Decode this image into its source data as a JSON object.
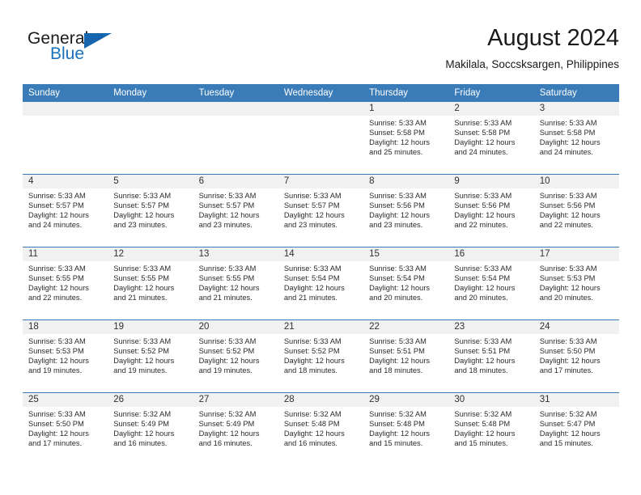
{
  "brand": {
    "name_part1": "General",
    "name_part2": "Blue"
  },
  "header": {
    "month_title": "August 2024",
    "location": "Makilala, Soccsksargen, Philippines"
  },
  "colors": {
    "header_blue": "#3a7cb8",
    "logo_blue": "#1872bc",
    "day_band": "#f1f1f1"
  },
  "weekdays": [
    "Sunday",
    "Monday",
    "Tuesday",
    "Wednesday",
    "Thursday",
    "Friday",
    "Saturday"
  ],
  "weeks": [
    [
      {
        "day": "",
        "sunrise": "",
        "sunset": "",
        "daylight_line1": "",
        "daylight_line2": ""
      },
      {
        "day": "",
        "sunrise": "",
        "sunset": "",
        "daylight_line1": "",
        "daylight_line2": ""
      },
      {
        "day": "",
        "sunrise": "",
        "sunset": "",
        "daylight_line1": "",
        "daylight_line2": ""
      },
      {
        "day": "",
        "sunrise": "",
        "sunset": "",
        "daylight_line1": "",
        "daylight_line2": ""
      },
      {
        "day": "1",
        "sunrise": "Sunrise: 5:33 AM",
        "sunset": "Sunset: 5:58 PM",
        "daylight_line1": "Daylight: 12 hours",
        "daylight_line2": "and 25 minutes."
      },
      {
        "day": "2",
        "sunrise": "Sunrise: 5:33 AM",
        "sunset": "Sunset: 5:58 PM",
        "daylight_line1": "Daylight: 12 hours",
        "daylight_line2": "and 24 minutes."
      },
      {
        "day": "3",
        "sunrise": "Sunrise: 5:33 AM",
        "sunset": "Sunset: 5:58 PM",
        "daylight_line1": "Daylight: 12 hours",
        "daylight_line2": "and 24 minutes."
      }
    ],
    [
      {
        "day": "4",
        "sunrise": "Sunrise: 5:33 AM",
        "sunset": "Sunset: 5:57 PM",
        "daylight_line1": "Daylight: 12 hours",
        "daylight_line2": "and 24 minutes."
      },
      {
        "day": "5",
        "sunrise": "Sunrise: 5:33 AM",
        "sunset": "Sunset: 5:57 PM",
        "daylight_line1": "Daylight: 12 hours",
        "daylight_line2": "and 23 minutes."
      },
      {
        "day": "6",
        "sunrise": "Sunrise: 5:33 AM",
        "sunset": "Sunset: 5:57 PM",
        "daylight_line1": "Daylight: 12 hours",
        "daylight_line2": "and 23 minutes."
      },
      {
        "day": "7",
        "sunrise": "Sunrise: 5:33 AM",
        "sunset": "Sunset: 5:57 PM",
        "daylight_line1": "Daylight: 12 hours",
        "daylight_line2": "and 23 minutes."
      },
      {
        "day": "8",
        "sunrise": "Sunrise: 5:33 AM",
        "sunset": "Sunset: 5:56 PM",
        "daylight_line1": "Daylight: 12 hours",
        "daylight_line2": "and 23 minutes."
      },
      {
        "day": "9",
        "sunrise": "Sunrise: 5:33 AM",
        "sunset": "Sunset: 5:56 PM",
        "daylight_line1": "Daylight: 12 hours",
        "daylight_line2": "and 22 minutes."
      },
      {
        "day": "10",
        "sunrise": "Sunrise: 5:33 AM",
        "sunset": "Sunset: 5:56 PM",
        "daylight_line1": "Daylight: 12 hours",
        "daylight_line2": "and 22 minutes."
      }
    ],
    [
      {
        "day": "11",
        "sunrise": "Sunrise: 5:33 AM",
        "sunset": "Sunset: 5:55 PM",
        "daylight_line1": "Daylight: 12 hours",
        "daylight_line2": "and 22 minutes."
      },
      {
        "day": "12",
        "sunrise": "Sunrise: 5:33 AM",
        "sunset": "Sunset: 5:55 PM",
        "daylight_line1": "Daylight: 12 hours",
        "daylight_line2": "and 21 minutes."
      },
      {
        "day": "13",
        "sunrise": "Sunrise: 5:33 AM",
        "sunset": "Sunset: 5:55 PM",
        "daylight_line1": "Daylight: 12 hours",
        "daylight_line2": "and 21 minutes."
      },
      {
        "day": "14",
        "sunrise": "Sunrise: 5:33 AM",
        "sunset": "Sunset: 5:54 PM",
        "daylight_line1": "Daylight: 12 hours",
        "daylight_line2": "and 21 minutes."
      },
      {
        "day": "15",
        "sunrise": "Sunrise: 5:33 AM",
        "sunset": "Sunset: 5:54 PM",
        "daylight_line1": "Daylight: 12 hours",
        "daylight_line2": "and 20 minutes."
      },
      {
        "day": "16",
        "sunrise": "Sunrise: 5:33 AM",
        "sunset": "Sunset: 5:54 PM",
        "daylight_line1": "Daylight: 12 hours",
        "daylight_line2": "and 20 minutes."
      },
      {
        "day": "17",
        "sunrise": "Sunrise: 5:33 AM",
        "sunset": "Sunset: 5:53 PM",
        "daylight_line1": "Daylight: 12 hours",
        "daylight_line2": "and 20 minutes."
      }
    ],
    [
      {
        "day": "18",
        "sunrise": "Sunrise: 5:33 AM",
        "sunset": "Sunset: 5:53 PM",
        "daylight_line1": "Daylight: 12 hours",
        "daylight_line2": "and 19 minutes."
      },
      {
        "day": "19",
        "sunrise": "Sunrise: 5:33 AM",
        "sunset": "Sunset: 5:52 PM",
        "daylight_line1": "Daylight: 12 hours",
        "daylight_line2": "and 19 minutes."
      },
      {
        "day": "20",
        "sunrise": "Sunrise: 5:33 AM",
        "sunset": "Sunset: 5:52 PM",
        "daylight_line1": "Daylight: 12 hours",
        "daylight_line2": "and 19 minutes."
      },
      {
        "day": "21",
        "sunrise": "Sunrise: 5:33 AM",
        "sunset": "Sunset: 5:52 PM",
        "daylight_line1": "Daylight: 12 hours",
        "daylight_line2": "and 18 minutes."
      },
      {
        "day": "22",
        "sunrise": "Sunrise: 5:33 AM",
        "sunset": "Sunset: 5:51 PM",
        "daylight_line1": "Daylight: 12 hours",
        "daylight_line2": "and 18 minutes."
      },
      {
        "day": "23",
        "sunrise": "Sunrise: 5:33 AM",
        "sunset": "Sunset: 5:51 PM",
        "daylight_line1": "Daylight: 12 hours",
        "daylight_line2": "and 18 minutes."
      },
      {
        "day": "24",
        "sunrise": "Sunrise: 5:33 AM",
        "sunset": "Sunset: 5:50 PM",
        "daylight_line1": "Daylight: 12 hours",
        "daylight_line2": "and 17 minutes."
      }
    ],
    [
      {
        "day": "25",
        "sunrise": "Sunrise: 5:33 AM",
        "sunset": "Sunset: 5:50 PM",
        "daylight_line1": "Daylight: 12 hours",
        "daylight_line2": "and 17 minutes."
      },
      {
        "day": "26",
        "sunrise": "Sunrise: 5:32 AM",
        "sunset": "Sunset: 5:49 PM",
        "daylight_line1": "Daylight: 12 hours",
        "daylight_line2": "and 16 minutes."
      },
      {
        "day": "27",
        "sunrise": "Sunrise: 5:32 AM",
        "sunset": "Sunset: 5:49 PM",
        "daylight_line1": "Daylight: 12 hours",
        "daylight_line2": "and 16 minutes."
      },
      {
        "day": "28",
        "sunrise": "Sunrise: 5:32 AM",
        "sunset": "Sunset: 5:48 PM",
        "daylight_line1": "Daylight: 12 hours",
        "daylight_line2": "and 16 minutes."
      },
      {
        "day": "29",
        "sunrise": "Sunrise: 5:32 AM",
        "sunset": "Sunset: 5:48 PM",
        "daylight_line1": "Daylight: 12 hours",
        "daylight_line2": "and 15 minutes."
      },
      {
        "day": "30",
        "sunrise": "Sunrise: 5:32 AM",
        "sunset": "Sunset: 5:48 PM",
        "daylight_line1": "Daylight: 12 hours",
        "daylight_line2": "and 15 minutes."
      },
      {
        "day": "31",
        "sunrise": "Sunrise: 5:32 AM",
        "sunset": "Sunset: 5:47 PM",
        "daylight_line1": "Daylight: 12 hours",
        "daylight_line2": "and 15 minutes."
      }
    ]
  ]
}
